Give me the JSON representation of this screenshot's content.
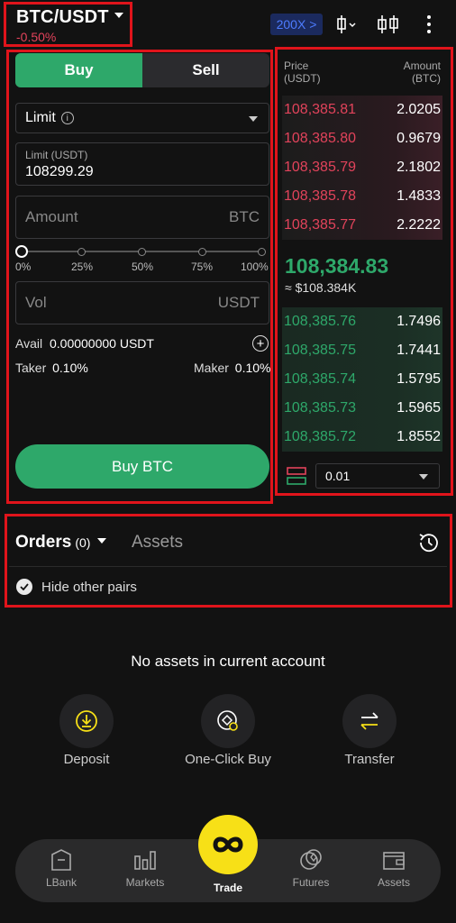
{
  "header": {
    "pair": "BTC/USDT",
    "change": "-0.50%",
    "leverage": "200X >"
  },
  "form": {
    "buy_tab": "Buy",
    "sell_tab": "Sell",
    "order_type": "Limit",
    "limit_label": "Limit (USDT)",
    "limit_value": "108299.29",
    "amount_placeholder": "Amount",
    "amount_unit": "BTC",
    "percent_marks": [
      "0%",
      "25%",
      "50%",
      "75%",
      "100%"
    ],
    "vol_placeholder": "Vol",
    "vol_unit": "USDT",
    "avail_label": "Avail",
    "avail_value": "0.00000000 USDT",
    "taker_label": "Taker",
    "taker_value": "0.10%",
    "maker_label": "Maker",
    "maker_value": "0.10%",
    "buy_button": "Buy BTC"
  },
  "orderbook": {
    "price_header": "Price\n(USDT)",
    "price_header_1": "Price",
    "price_header_2": "(USDT)",
    "amount_header_1": "Amount",
    "amount_header_2": "(BTC)",
    "asks": [
      {
        "price": "108,385.81",
        "amount": "2.0205"
      },
      {
        "price": "108,385.80",
        "amount": "0.9679"
      },
      {
        "price": "108,385.79",
        "amount": "2.1802"
      },
      {
        "price": "108,385.78",
        "amount": "1.4833"
      },
      {
        "price": "108,385.77",
        "amount": "2.2222"
      }
    ],
    "last_price": "108,384.83",
    "last_fiat": "≈ $108.384K",
    "bids": [
      {
        "price": "108,385.76",
        "amount": "1.7496"
      },
      {
        "price": "108,385.75",
        "amount": "1.7441"
      },
      {
        "price": "108,385.74",
        "amount": "1.5795"
      },
      {
        "price": "108,385.73",
        "amount": "1.5965"
      },
      {
        "price": "108,385.72",
        "amount": "1.8552"
      }
    ],
    "depth": "0.01"
  },
  "orders": {
    "orders_tab": "Orders",
    "orders_count": "(0)",
    "assets_tab": "Assets",
    "hide_other_pairs": "Hide other pairs"
  },
  "empty": {
    "message": "No assets in current account",
    "actions": [
      "Deposit",
      "One-Click Buy",
      "Transfer"
    ]
  },
  "nav": {
    "items": [
      "LBank",
      "Markets",
      "Trade",
      "Futures",
      "Assets"
    ]
  },
  "colors": {
    "green": "#2ea86a",
    "red": "#e2435b",
    "yellow": "#f7e017",
    "highlight": "#e0141b"
  }
}
